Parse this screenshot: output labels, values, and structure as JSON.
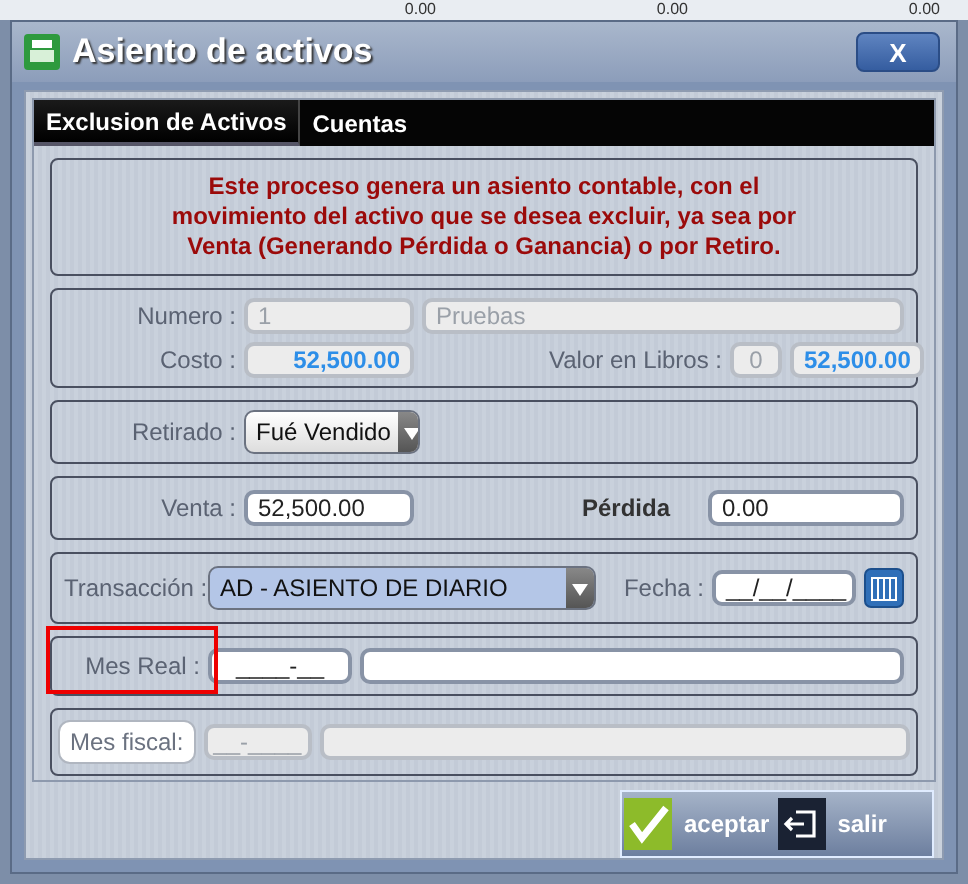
{
  "background_cells": [
    "0.00",
    "0.00",
    "0.00"
  ],
  "window": {
    "title": "Asiento de activos",
    "close": "X"
  },
  "tabs": [
    {
      "label": "Exclusion de Activos",
      "selected": true
    },
    {
      "label": "Cuentas",
      "selected": false
    }
  ],
  "notice": "Este proceso genera un asiento contable, con el movimiento del activo que se desea excluir, ya sea por Venta (Generando Pérdida o Ganancia)  o por Retiro.",
  "asset": {
    "numero_label": "Numero :",
    "numero": {
      "value": "1",
      "disabled": true
    },
    "nombre": {
      "value": "Pruebas",
      "disabled": true
    },
    "costo_label": "Costo :",
    "costo": {
      "value": "52,500.00",
      "disabled": true
    },
    "libros_label": "Valor en Libros :",
    "libros_count": {
      "value": "0",
      "disabled": true
    },
    "libros": {
      "value": "52,500.00",
      "disabled": true
    }
  },
  "retirado": {
    "label": "Retirado :",
    "value": "Fué Vendido"
  },
  "venta": {
    "label": "Venta :",
    "value": "52,500.00",
    "disabled": false
  },
  "perdida": {
    "label": "Pérdida",
    "value": "0.00",
    "disabled": false
  },
  "transaccion": {
    "label": "Transacción :",
    "value": "AD - ASIENTO DE DIARIO"
  },
  "fecha": {
    "label": "Fecha :",
    "value": "__/__/____",
    "disabled": false
  },
  "mes_real": {
    "label": "Mes Real :",
    "value": "____-__",
    "disabled": false,
    "highlighted": true
  },
  "mes_fiscal": {
    "label": "Mes fiscal:",
    "value": "__-____",
    "disabled": true
  },
  "buttons": [
    {
      "label": "aceptar",
      "kind": "accept"
    },
    {
      "label": "salir",
      "kind": "exit"
    }
  ]
}
